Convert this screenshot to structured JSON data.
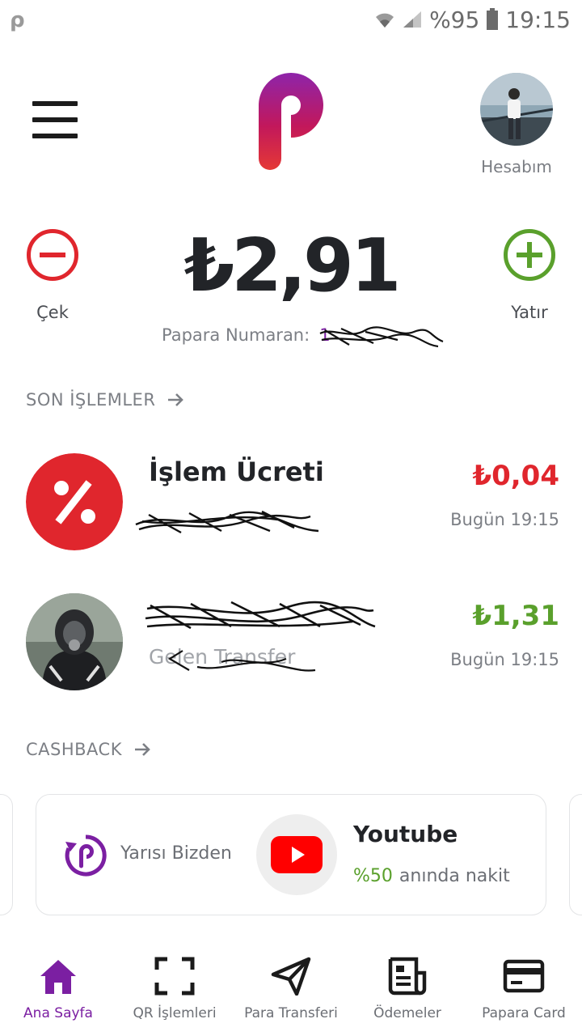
{
  "status_bar": {
    "battery": "%95",
    "time": "19:15"
  },
  "header": {
    "account_label": "Hesabım"
  },
  "balance": {
    "amount": "₺2,91",
    "withdraw_label": "Çek",
    "deposit_label": "Yatır",
    "papara_number_label": "Papara Numaran:",
    "papara_number_value": "1"
  },
  "recent": {
    "title": "SON İŞLEMLER",
    "transactions": [
      {
        "title": "İşlem Ücreti",
        "subtitle": "",
        "amount": "₺0,04",
        "amount_color": "#e0262d",
        "time": "Bugün 19:15"
      },
      {
        "title": "",
        "subtitle": "Gelen Transfer",
        "amount": "₺1,31",
        "amount_color": "#5aa02c",
        "time": "Bugün 19:15"
      }
    ]
  },
  "cashback": {
    "title": "CASHBACK",
    "card": {
      "label": "Yarısı Bizden",
      "brand": "Youtube",
      "percent": "%50",
      "offer_text": "anında nakit"
    }
  },
  "nav": {
    "items": [
      {
        "label": "Ana Sayfa",
        "icon": "home-icon",
        "active": true
      },
      {
        "label": "QR İşlemleri",
        "icon": "qr-scan-icon",
        "active": false
      },
      {
        "label": "Para Transferi",
        "icon": "send-icon",
        "active": false
      },
      {
        "label": "Ödemeler",
        "icon": "bill-icon",
        "active": false
      },
      {
        "label": "Papara Card",
        "icon": "card-icon",
        "active": false
      }
    ]
  },
  "colors": {
    "brand_purple": "#7b1fa2",
    "negative_red": "#e0262d",
    "positive_green": "#5aa02c"
  }
}
